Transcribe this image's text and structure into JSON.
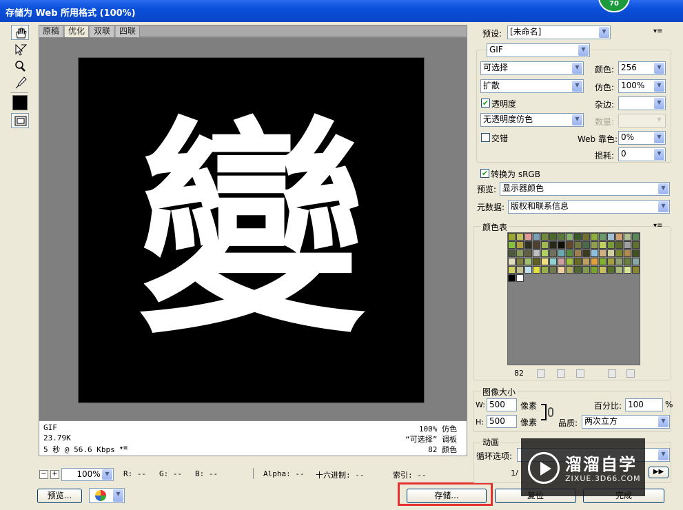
{
  "window": {
    "title": "存储为 Web 所用格式 (100%)",
    "badge": "70"
  },
  "tabs": [
    "原稿",
    "优化",
    "双联",
    "四联"
  ],
  "artwork": {
    "glyph": "變"
  },
  "info": {
    "left": [
      "GIF",
      "23.79K",
      "5 秒 @ 56.6 Kbps"
    ],
    "right": [
      "100% 仿色",
      "“可选择” 调板",
      "82 颜色"
    ]
  },
  "status": {
    "zoom": "100%",
    "r": "R: --",
    "g": "G: --",
    "b": "B: --",
    "alpha": "Alpha: --",
    "hex": "十六进制: --",
    "index": "索引: --"
  },
  "buttons": {
    "preview": "预览...",
    "save": "存储...",
    "cancel": "复位",
    "done": "完成"
  },
  "settings": {
    "preset_label": "预设:",
    "preset_value": "[未命名]",
    "format": "GIF",
    "reduction": "可选择",
    "dither_algo": "扩散",
    "transparency_label": "透明度",
    "transparency_dither": "无透明度仿色",
    "interlaced_label": "交错",
    "colors_label": "颜色:",
    "colors_value": "256",
    "dither_label": "仿色:",
    "dither_value": "100%",
    "matte_label": "杂边:",
    "amount_label": "数量:",
    "websnap_label": "Web 靠色:",
    "websnap_value": "0%",
    "lossy_label": "损耗:",
    "lossy_value": "0",
    "srgb_label": "转换为 sRGB",
    "preview_label": "预览:",
    "preview_value": "显示器颜色",
    "metadata_label": "元数据:",
    "metadata_value": "版权和联系信息"
  },
  "color_table": {
    "title": "颜色表",
    "count": "82",
    "colors": [
      "#9aa830",
      "#c0c05a",
      "#e09a9a",
      "#7aa0b8",
      "#6e8a3a",
      "#4a6a2a",
      "#5a7a3a",
      "#8ab070",
      "#3a5a2a",
      "#707030",
      "#90b040",
      "#6a9a6a",
      "#a0c0d0",
      "#d0a070",
      "#b0c090",
      "#5a8a5a",
      "#88c040",
      "#b0a040",
      "#303020",
      "#504030",
      "#a0b850",
      "#282818",
      "#101008",
      "#604828",
      "#707840",
      "#4a6a4a",
      "#90a050",
      "#c0d060",
      "#7a9a3a",
      "#5a6a2a",
      "#a0a0a0",
      "#607030",
      "#4a5a3a",
      "#8a9a5a",
      "#606040",
      "#c0c0c0",
      "#b0d060",
      "#707060",
      "#6aaab0",
      "#5a8a40",
      "#a08050",
      "#3a3a20",
      "#90c0e0",
      "#d0b080",
      "#d0d0a0",
      "#7a8a2a",
      "#b08a50",
      "#405020",
      "#e0e0c0",
      "#808040",
      "#a0c070",
      "#606020",
      "#f0e080",
      "#90d0d0",
      "#d0a0a0",
      "#a0c040",
      "#6a6a20",
      "#c0a060",
      "#e0a040",
      "#80b030",
      "#a0a040",
      "#90a070",
      "#6a8040",
      "#88a8a8",
      "#d0d060",
      "#c0c090",
      "#c0e0f0",
      "#e0e040",
      "#98b048",
      "#707850",
      "#f0d0a0",
      "#b0b060",
      "#506830",
      "#809850",
      "#7aa030",
      "#c8c060",
      "#587028",
      "#a8b878",
      "#d8e898",
      "#888830",
      "#000000",
      "#ffffff"
    ]
  },
  "image_size": {
    "title": "图像大小",
    "w_label": "W:",
    "w_value": "500",
    "h_label": "H:",
    "h_value": "500",
    "unit": "像素",
    "percent_label": "百分比:",
    "percent_value": "100",
    "percent_sign": "%",
    "quality_label": "品质:",
    "quality_value": "两次立方"
  },
  "animation": {
    "title": "动画",
    "loop_label": "循环选项:",
    "frame": "1/"
  },
  "watermark": {
    "brand": "溜溜自学",
    "url": "ZIXUE.3D66.COM"
  }
}
